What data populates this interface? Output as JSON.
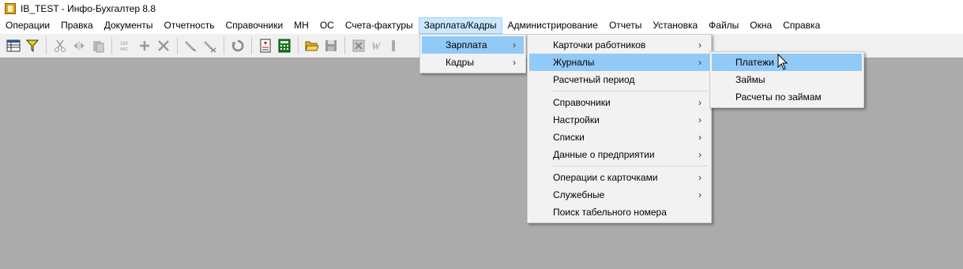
{
  "window": {
    "title": "IB_TEST - Инфо-Бухгалтер 8.8"
  },
  "menubar": {
    "items": [
      {
        "label": "Операции"
      },
      {
        "label": "Правка"
      },
      {
        "label": "Документы"
      },
      {
        "label": "Отчетность"
      },
      {
        "label": "Справочники"
      },
      {
        "label": "МН"
      },
      {
        "label": "ОС"
      },
      {
        "label": "Счета-фактуры"
      },
      {
        "label": "Зарплата/Кадры"
      },
      {
        "label": "Администрирование"
      },
      {
        "label": "Отчеты"
      },
      {
        "label": "Установка"
      },
      {
        "label": "Файлы"
      },
      {
        "label": "Окна"
      },
      {
        "label": "Справка"
      }
    ]
  },
  "menu_level1": {
    "items": [
      {
        "label": "Зарплата",
        "arrow": "›"
      },
      {
        "label": "Кадры",
        "arrow": "›"
      }
    ]
  },
  "menu_level2": {
    "items": [
      {
        "label": "Карточки работников",
        "arrow": "›"
      },
      {
        "label": "Журналы",
        "arrow": "›"
      },
      {
        "label": "Расчетный период",
        "arrow": ""
      },
      {
        "label": "Справочники",
        "arrow": "›"
      },
      {
        "label": "Настройки",
        "arrow": "›"
      },
      {
        "label": "Списки",
        "arrow": "›"
      },
      {
        "label": "Данные о предприятии",
        "arrow": "›"
      },
      {
        "label": "Операции с карточками",
        "arrow": "›"
      },
      {
        "label": "Служебные",
        "arrow": "›"
      },
      {
        "label": "Поиск табельного номера",
        "arrow": ""
      }
    ]
  },
  "menu_level3": {
    "items": [
      {
        "label": "Платежи"
      },
      {
        "label": "Займы"
      },
      {
        "label": "Расчеты по займам"
      }
    ]
  },
  "colors": {
    "highlight": "#91c9f7",
    "workspace": "#ababab"
  }
}
